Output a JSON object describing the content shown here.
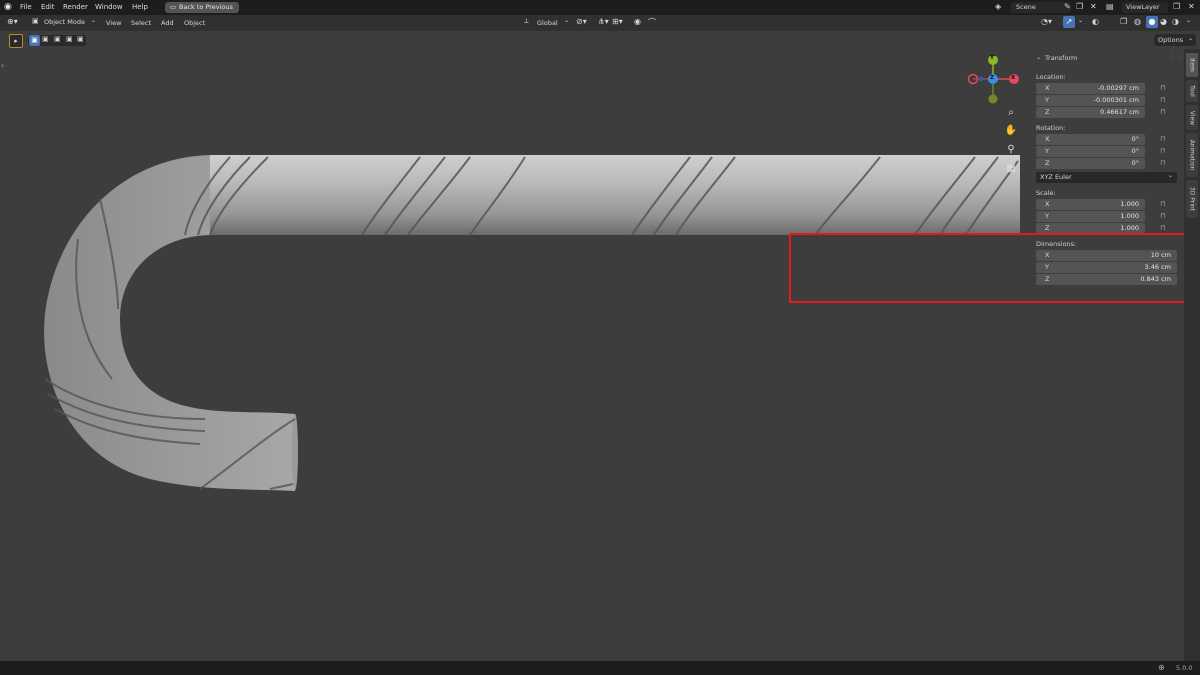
{
  "menu": {
    "items": [
      "File",
      "Edit",
      "Render",
      "Window",
      "Help"
    ],
    "back_button": "Back to Previous"
  },
  "scene": {
    "label": "Scene"
  },
  "view_layer": {
    "label": "ViewLayer"
  },
  "header": {
    "mode": "Object Mode",
    "menus": [
      "View",
      "Select",
      "Add",
      "Object"
    ],
    "orientation": "Global",
    "options": "Options"
  },
  "gizmo": {
    "x": "X",
    "y": "Y",
    "z": "Z"
  },
  "transform": {
    "title": "Transform",
    "location_label": "Location:",
    "location": [
      {
        "axis": "X",
        "value": "-0.00297 cm"
      },
      {
        "axis": "Y",
        "value": "-0.000301 cm"
      },
      {
        "axis": "Z",
        "value": "0.46617 cm"
      }
    ],
    "rotation_label": "Rotation:",
    "rotation": [
      {
        "axis": "X",
        "value": "0°"
      },
      {
        "axis": "Y",
        "value": "0°"
      },
      {
        "axis": "Z",
        "value": "0°"
      }
    ],
    "rotation_mode": "XYZ Euler",
    "scale_label": "Scale:",
    "scale": [
      {
        "axis": "X",
        "value": "1.000"
      },
      {
        "axis": "Y",
        "value": "1.000"
      },
      {
        "axis": "Z",
        "value": "1.000"
      }
    ],
    "dimensions_label": "Dimensions:",
    "dimensions": [
      {
        "axis": "X",
        "value": "10 cm"
      },
      {
        "axis": "Y",
        "value": "3.46 cm"
      },
      {
        "axis": "Z",
        "value": "0.843 cm"
      }
    ]
  },
  "side_tabs": [
    "Item",
    "Tool",
    "View",
    "Animation",
    "3D Print"
  ],
  "status": {
    "version": "5.0.0"
  },
  "colors": {
    "highlight": "#e01b1b",
    "x_axis": "#e04a5a",
    "y_axis": "#8ab628",
    "z_axis": "#3b8ee0"
  }
}
